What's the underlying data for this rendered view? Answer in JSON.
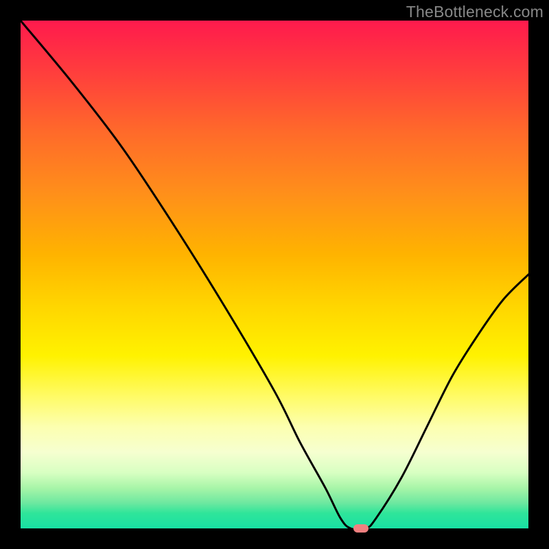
{
  "watermark": "TheBottleneck.com",
  "chart_data": {
    "type": "line",
    "title": "",
    "xlabel": "",
    "ylabel": "",
    "xlim": [
      0,
      100
    ],
    "ylim": [
      0,
      100
    ],
    "series": [
      {
        "name": "bottleneck-curve",
        "x": [
          0,
          10,
          20,
          30,
          40,
          50,
          55,
          60,
          63,
          65,
          68,
          70,
          75,
          80,
          85,
          90,
          95,
          100
        ],
        "y": [
          100,
          88,
          75,
          60,
          44,
          27,
          17,
          8,
          2,
          0,
          0,
          2,
          10,
          20,
          30,
          38,
          45,
          50
        ]
      }
    ],
    "marker": {
      "x": 67,
      "y": 0
    }
  }
}
